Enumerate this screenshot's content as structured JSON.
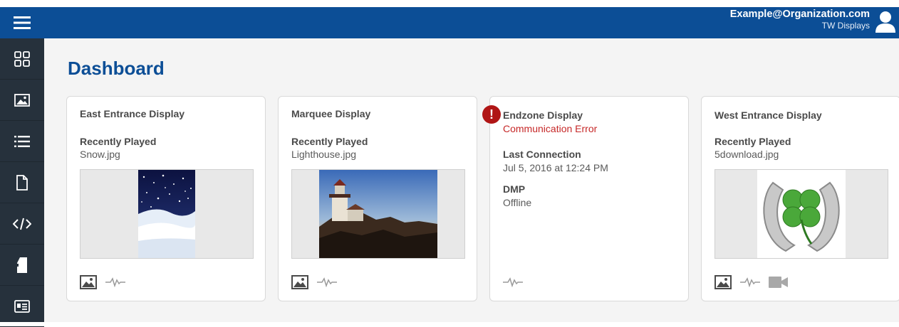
{
  "header": {
    "user_email": "Example@Organization.com",
    "organization": "TW Displays"
  },
  "sidebar": {
    "menu_icon": "hamburger-menu-icon",
    "items": [
      {
        "icon": "dashboard-grid-icon"
      },
      {
        "icon": "image-library-icon"
      },
      {
        "icon": "list-icon"
      },
      {
        "icon": "document-icon"
      },
      {
        "icon": "code-icon"
      },
      {
        "icon": "device-icon"
      },
      {
        "icon": "id-card-icon"
      }
    ]
  },
  "page": {
    "title": "Dashboard"
  },
  "cards": [
    {
      "name": "East Entrance Display",
      "recent_label": "Recently Played",
      "recent_file": "Snow.jpg"
    },
    {
      "name": "Marquee Display",
      "recent_label": "Recently Played",
      "recent_file": "Lighthouse.jpg"
    },
    {
      "name": "Endzone Display",
      "status": "Communication Error",
      "alert_mark": "!",
      "last_connection_label": "Last Connection",
      "last_connection_value": "Jul 5, 2016 at 12:24 PM",
      "dmp_label": "DMP",
      "dmp_value": "Offline"
    },
    {
      "name": "West Entrance Display",
      "recent_label": "Recently Played",
      "recent_file": "5download.jpg"
    }
  ],
  "colors": {
    "brand_blue": "#0c4e96",
    "sidebar_dark": "#26313c",
    "error_red": "#c62828",
    "alert_red": "#b01515"
  }
}
